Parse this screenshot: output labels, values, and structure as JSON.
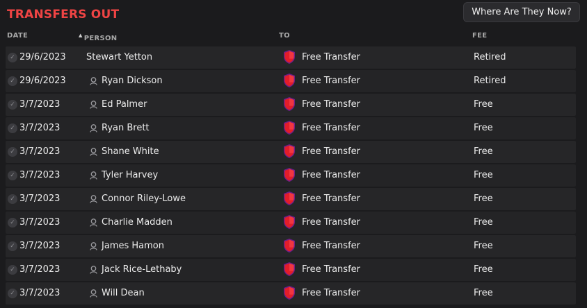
{
  "panel": {
    "title": "TRANSFERS OUT",
    "where_button_label": "Where Are They Now?"
  },
  "columns": {
    "date": "DATE",
    "person": "PERSON",
    "to": "TO",
    "fee": "FEE",
    "sorted_by": "person"
  },
  "colors": {
    "title": "#ef4444",
    "background": "#1b1b1d",
    "row_bg": "#242426",
    "club_shield": "#e11d2a",
    "club_shield_border": "#7c3aed"
  },
  "rows": [
    {
      "date": "29/6/2023",
      "person": "Stewart Yetton",
      "show_person_icon": false,
      "to": "Free Transfer",
      "fee": "Retired"
    },
    {
      "date": "29/6/2023",
      "person": "Ryan Dickson",
      "show_person_icon": true,
      "to": "Free Transfer",
      "fee": "Retired"
    },
    {
      "date": "3/7/2023",
      "person": "Ed Palmer",
      "show_person_icon": true,
      "to": "Free Transfer",
      "fee": "Free"
    },
    {
      "date": "3/7/2023",
      "person": "Ryan Brett",
      "show_person_icon": true,
      "to": "Free Transfer",
      "fee": "Free"
    },
    {
      "date": "3/7/2023",
      "person": "Shane White",
      "show_person_icon": true,
      "to": "Free Transfer",
      "fee": "Free"
    },
    {
      "date": "3/7/2023",
      "person": "Tyler Harvey",
      "show_person_icon": true,
      "to": "Free Transfer",
      "fee": "Free"
    },
    {
      "date": "3/7/2023",
      "person": "Connor Riley-Lowe",
      "show_person_icon": true,
      "to": "Free Transfer",
      "fee": "Free"
    },
    {
      "date": "3/7/2023",
      "person": "Charlie Madden",
      "show_person_icon": true,
      "to": "Free Transfer",
      "fee": "Free"
    },
    {
      "date": "3/7/2023",
      "person": "James Hamon",
      "show_person_icon": true,
      "to": "Free Transfer",
      "fee": "Free"
    },
    {
      "date": "3/7/2023",
      "person": "Jack Rice-Lethaby",
      "show_person_icon": true,
      "to": "Free Transfer",
      "fee": "Free"
    },
    {
      "date": "3/7/2023",
      "person": "Will Dean",
      "show_person_icon": true,
      "to": "Free Transfer",
      "fee": "Free"
    }
  ]
}
